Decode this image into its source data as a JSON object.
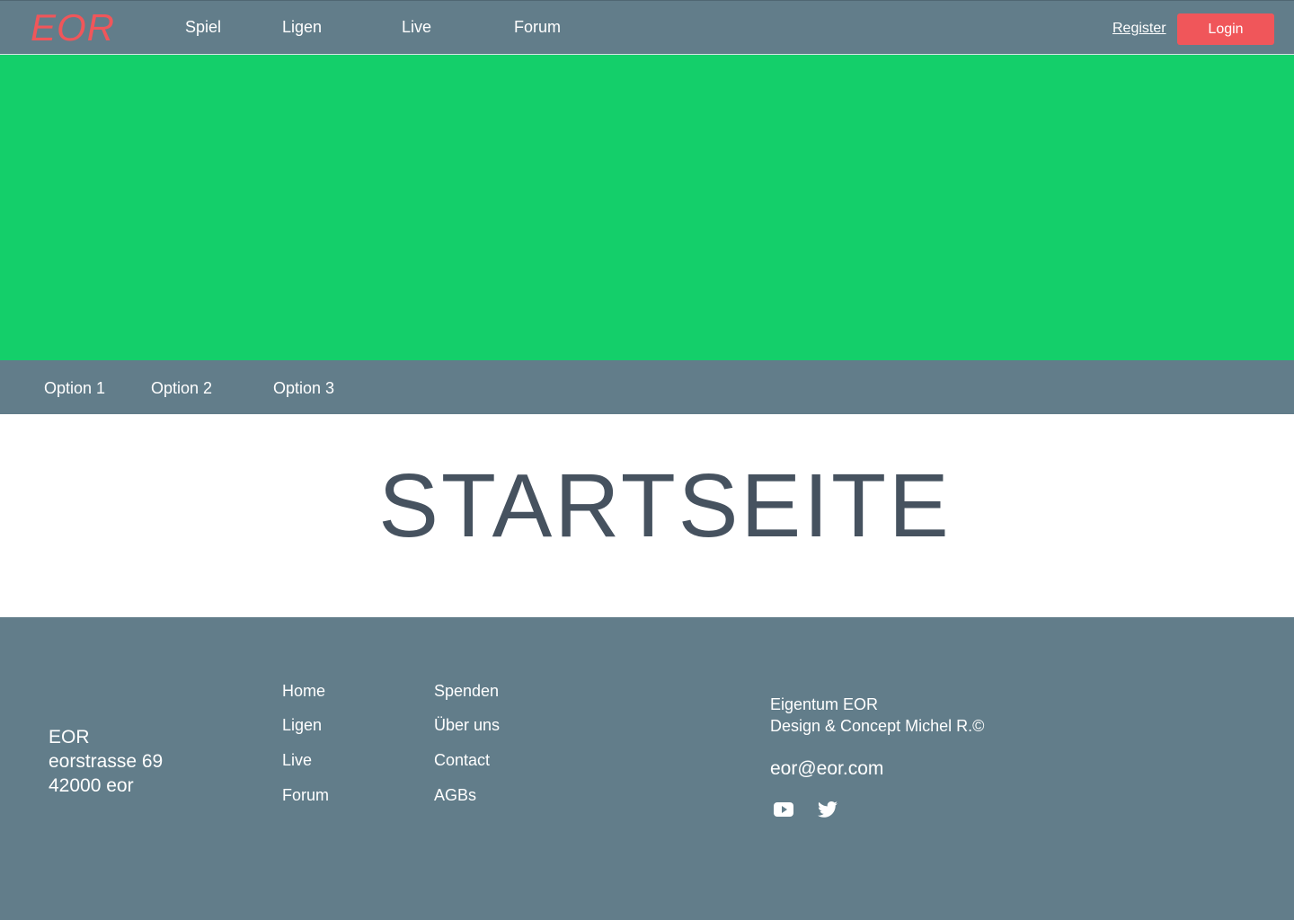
{
  "header": {
    "logo": "EOR",
    "nav": [
      "Spiel",
      "Ligen",
      "Live",
      "Forum"
    ],
    "register_label": "Register",
    "login_label": "Login"
  },
  "colors": {
    "header_bg": "#627d8a",
    "hero_bg": "#14cf6a",
    "accent": "#f0565a",
    "title_text": "#46525f"
  },
  "subnav": [
    "Option 1",
    "Option 2",
    "Option 3"
  ],
  "main": {
    "title": "STARTSEITE"
  },
  "footer": {
    "address": [
      "EOR",
      "eorstrasse 69",
      "42000 eor"
    ],
    "links_col1": [
      "Home",
      "Ligen",
      "Live",
      "Forum"
    ],
    "links_col2": [
      "Spenden",
      "Über uns",
      "Contact",
      "AGBs"
    ],
    "legal": [
      "Eigentum EOR",
      "Design & Concept Michel R.©"
    ],
    "email": "eor@eor.com",
    "social_icons": [
      "youtube-icon",
      "twitter-icon"
    ]
  }
}
